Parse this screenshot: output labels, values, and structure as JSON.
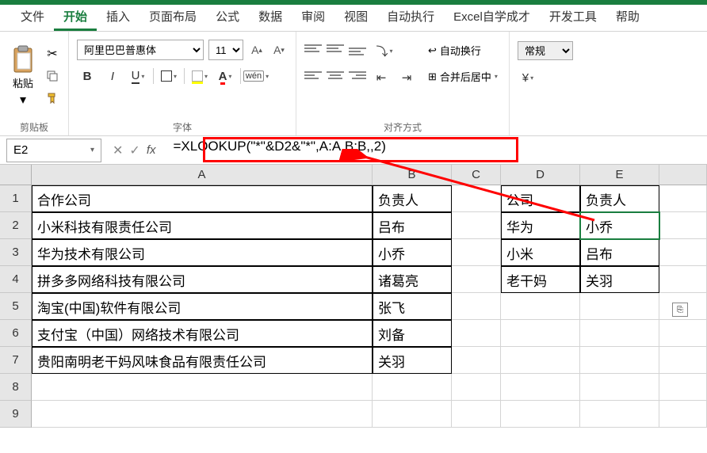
{
  "menu": {
    "tabs": [
      "文件",
      "开始",
      "插入",
      "页面布局",
      "公式",
      "数据",
      "审阅",
      "视图",
      "自动执行",
      "Excel自学成才",
      "开发工具",
      "帮助"
    ],
    "active_index": 1
  },
  "ribbon": {
    "clipboard": {
      "paste": "粘贴",
      "label": "剪贴板"
    },
    "font": {
      "name": "阿里巴巴普惠体",
      "size": "11",
      "label": "字体",
      "bold": "B",
      "italic": "I",
      "underline": "U",
      "wen": "wén"
    },
    "alignment": {
      "wrap": "自动换行",
      "merge": "合并后居中",
      "label": "对齐方式"
    },
    "number": {
      "format": "常规"
    }
  },
  "formula_bar": {
    "cell_ref": "E2",
    "formula": "=XLOOKUP(\"*\"&D2&\"*\",A:A,B:B,,2)"
  },
  "grid": {
    "columns": [
      "A",
      "B",
      "C",
      "D",
      "E"
    ],
    "rows": [
      {
        "n": 1,
        "A": "合作公司",
        "B": "负责人",
        "D": "公司",
        "E": "负责人"
      },
      {
        "n": 2,
        "A": "小米科技有限责任公司",
        "B": "吕布",
        "D": "华为",
        "E": "小乔"
      },
      {
        "n": 3,
        "A": "华为技术有限公司",
        "B": "小乔",
        "D": "小米",
        "E": "吕布"
      },
      {
        "n": 4,
        "A": "拼多多网络科技有限公司",
        "B": "诸葛亮",
        "D": "老干妈",
        "E": "关羽"
      },
      {
        "n": 5,
        "A": "淘宝(中国)软件有限公司",
        "B": "张飞",
        "D": "",
        "E": ""
      },
      {
        "n": 6,
        "A": "支付宝（中国）网络技术有限公司",
        "B": "刘备",
        "D": "",
        "E": ""
      },
      {
        "n": 7,
        "A": "贵阳南明老干妈风味食品有限责任公司",
        "B": "关羽",
        "D": "",
        "E": ""
      },
      {
        "n": 8,
        "A": "",
        "B": "",
        "D": "",
        "E": ""
      },
      {
        "n": 9,
        "A": "",
        "B": "",
        "D": "",
        "E": ""
      }
    ],
    "selected": "E2"
  }
}
